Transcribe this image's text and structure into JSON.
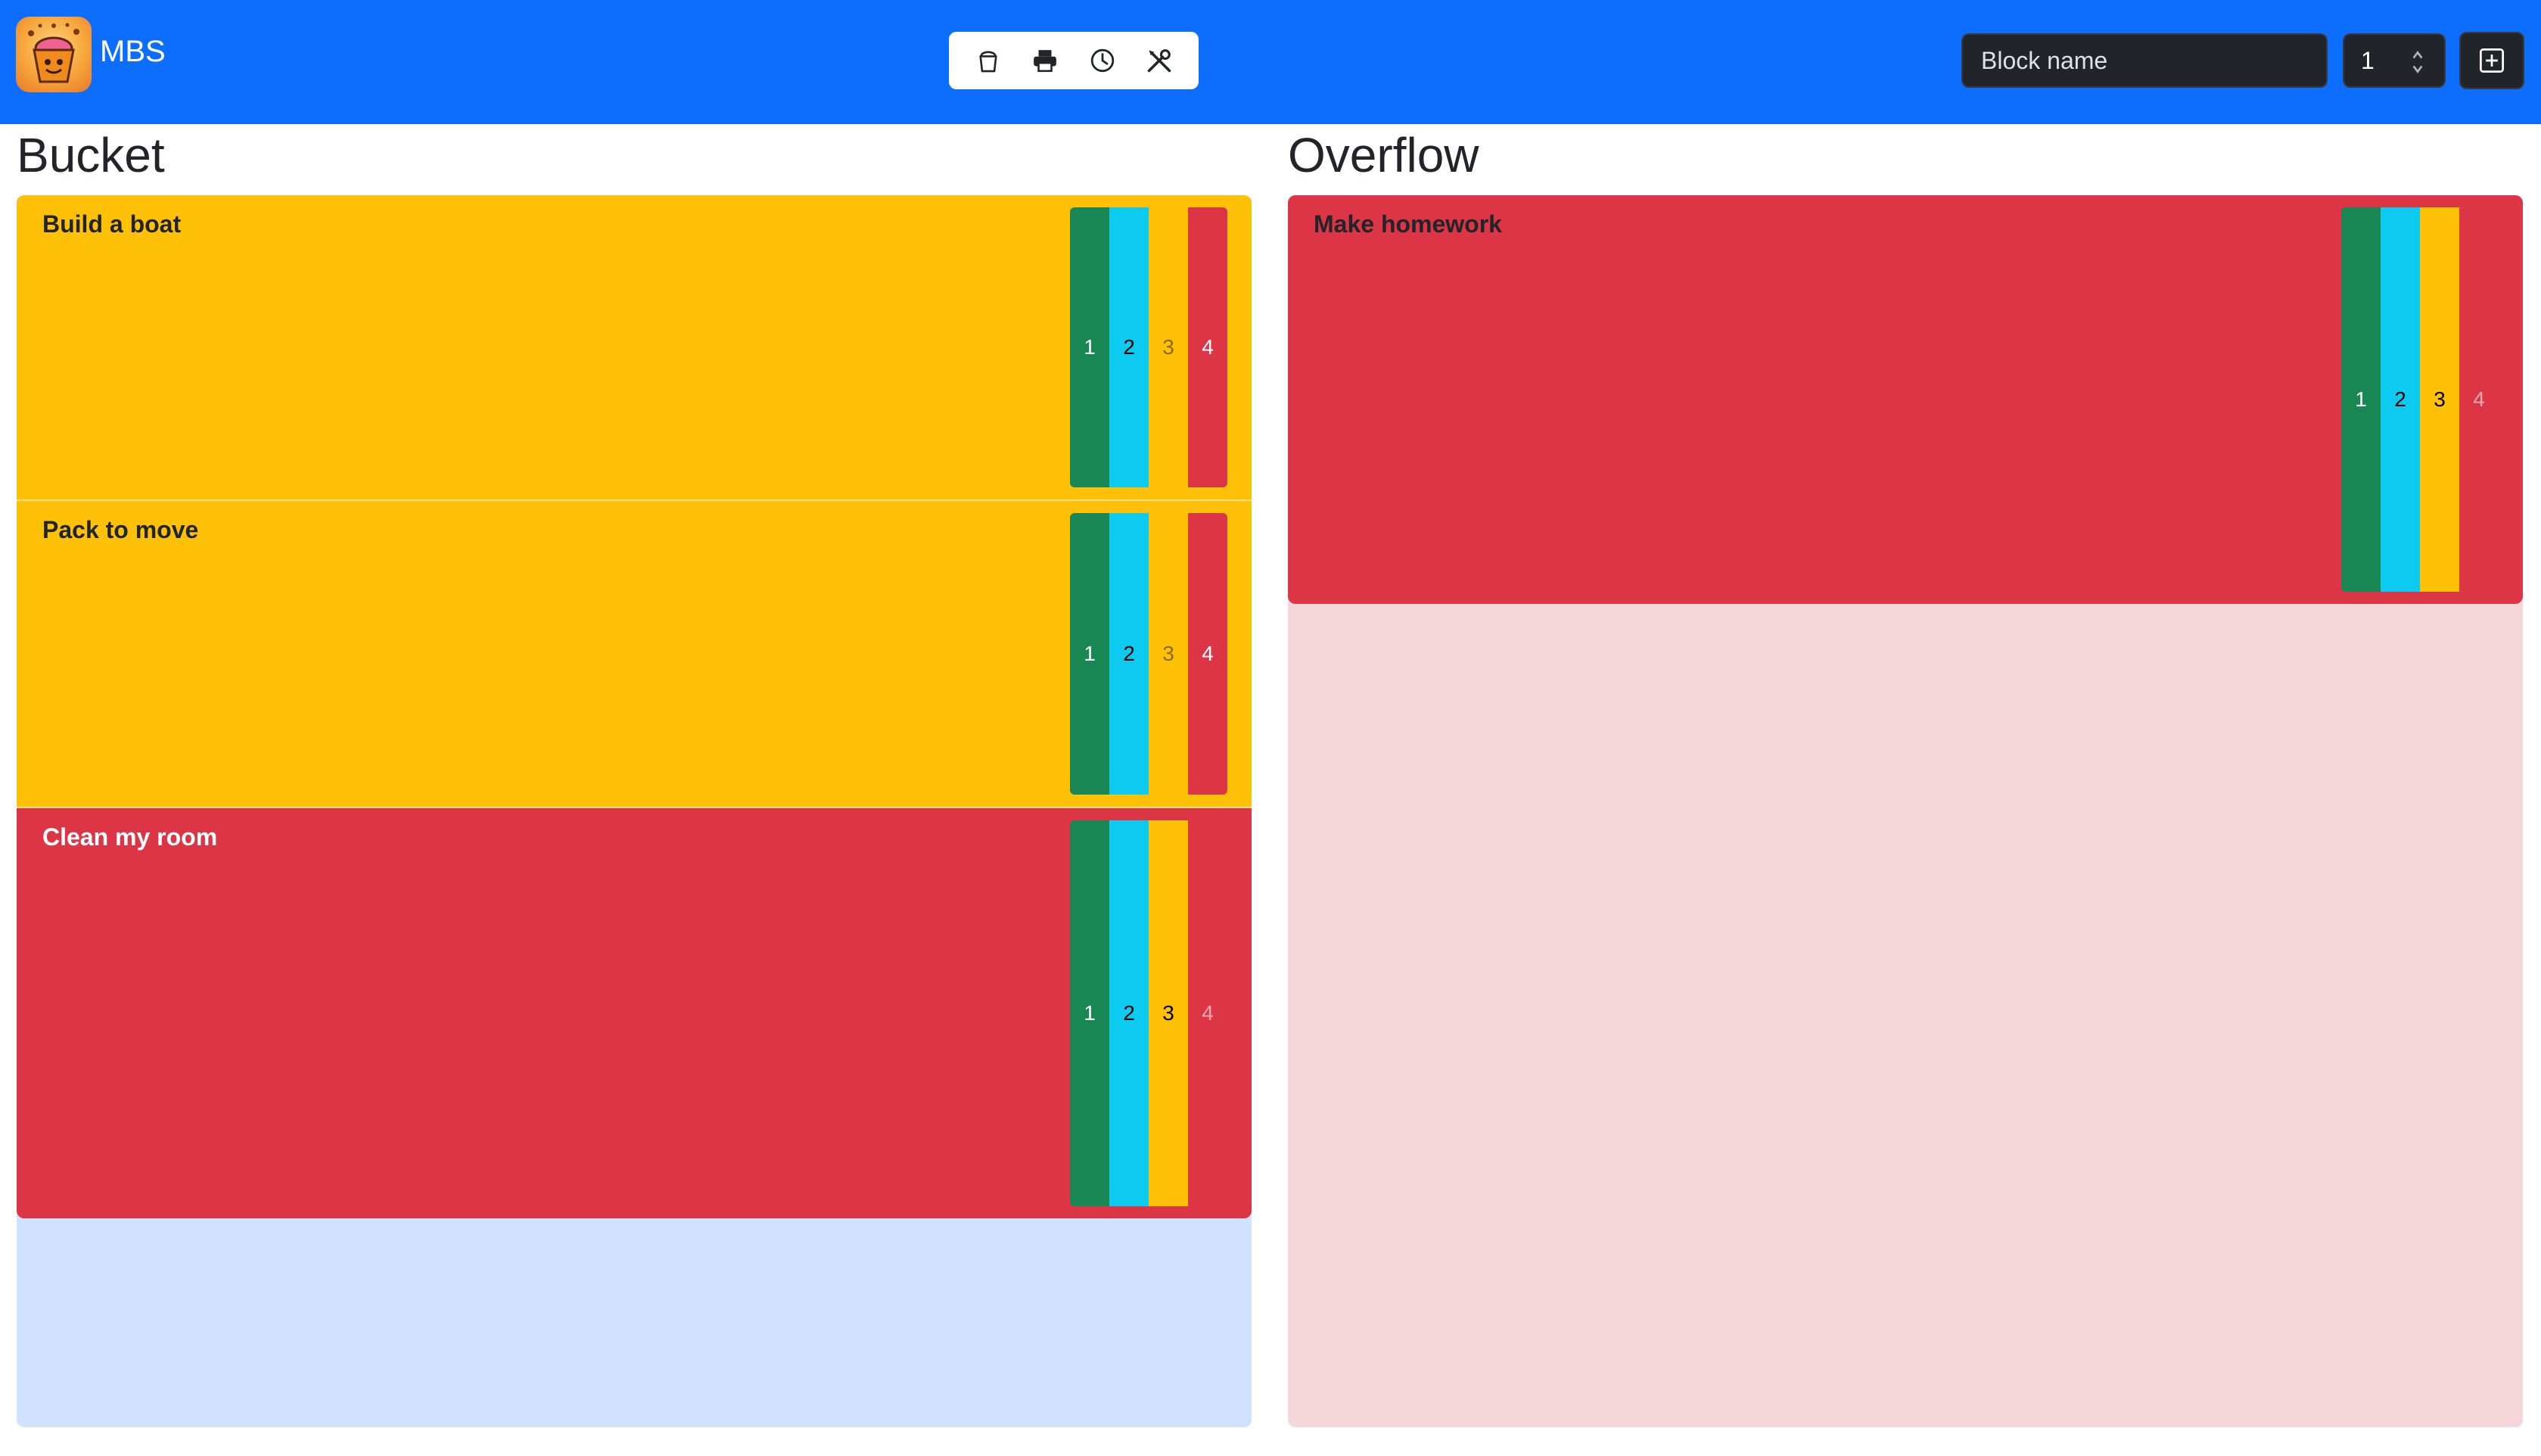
{
  "app": {
    "title": "MBS"
  },
  "toolbar": {
    "icons": [
      "bucket-icon",
      "printer-icon",
      "clock-icon",
      "tools-icon"
    ]
  },
  "add_block": {
    "name_placeholder": "Block name",
    "priority_value": "1"
  },
  "columns": {
    "bucket": {
      "title": "Bucket",
      "blocks": [
        {
          "title": "Build a boat",
          "color": "#ffc107",
          "priorities": [
            "1",
            "2",
            "3",
            "4"
          ]
        },
        {
          "title": "Pack to move",
          "color": "#ffc107",
          "priorities": [
            "1",
            "2",
            "3",
            "4"
          ]
        },
        {
          "title": "Clean my room",
          "color": "#dc3545",
          "priorities": [
            "1",
            "2",
            "3",
            "4"
          ]
        }
      ]
    },
    "overflow": {
      "title": "Overflow",
      "blocks": [
        {
          "title": "Make homework",
          "color": "#dc3545",
          "priorities": [
            "1",
            "2",
            "3",
            "4"
          ]
        }
      ]
    }
  },
  "colors": {
    "navbar": "#0d6efd",
    "priority_1": "#198754",
    "priority_2": "#0dcaf0",
    "priority_3": "#ffc107",
    "priority_4": "#dc3545",
    "bucket_zone": "#cfe2ff",
    "overflow_zone": "#f5d7db"
  }
}
